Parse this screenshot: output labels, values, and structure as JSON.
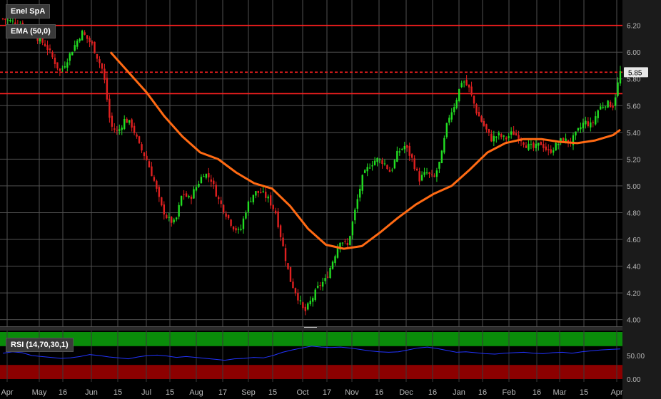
{
  "chart_data": [
    {
      "type": "candlestick",
      "title": "Enel SpA",
      "indicator": "EMA (50,0)",
      "y_ticks": [
        "6.20",
        "6.00",
        "5.80",
        "5.60",
        "5.40",
        "5.20",
        "5.00",
        "4.80",
        "4.60",
        "4.40",
        "4.20",
        "4.00"
      ],
      "ylim": [
        3.95,
        6.39
      ],
      "last_price": "5.85",
      "horizontal_lines": [
        {
          "value": 6.2,
          "style": "solid"
        },
        {
          "value": 5.85,
          "style": "dashed"
        },
        {
          "value": 5.69,
          "style": "solid"
        }
      ],
      "x_labels": [
        "Apr",
        "May",
        "16",
        "Jun",
        "15",
        "Jul",
        "15",
        "Aug",
        "17",
        "Sep",
        "15",
        "Oct",
        "17",
        "Nov",
        "16",
        "Dec",
        "16",
        "Jan",
        "16",
        "Feb",
        "16",
        "Mar",
        "15",
        "Apr"
      ],
      "close_path": [
        [
          0,
          6.25
        ],
        [
          6,
          6.2
        ],
        [
          12,
          6.05
        ],
        [
          16,
          5.85
        ],
        [
          19,
          6.0
        ],
        [
          22,
          6.15
        ],
        [
          25,
          6.05
        ],
        [
          28,
          5.85
        ],
        [
          30,
          5.45
        ],
        [
          32,
          5.4
        ],
        [
          34,
          5.5
        ],
        [
          36,
          5.45
        ],
        [
          38,
          5.3
        ],
        [
          40,
          5.2
        ],
        [
          42,
          5.05
        ],
        [
          44,
          4.85
        ],
        [
          46,
          4.75
        ],
        [
          48,
          4.72
        ],
        [
          50,
          4.95
        ],
        [
          52,
          4.9
        ],
        [
          54,
          5.0
        ],
        [
          56,
          5.1
        ],
        [
          58,
          5.05
        ],
        [
          60,
          4.9
        ],
        [
          62,
          4.8
        ],
        [
          64,
          4.7
        ],
        [
          66,
          4.65
        ],
        [
          68,
          4.85
        ],
        [
          70,
          4.95
        ],
        [
          72,
          4.95
        ],
        [
          74,
          4.9
        ],
        [
          76,
          4.8
        ],
        [
          78,
          4.55
        ],
        [
          80,
          4.3
        ],
        [
          82,
          4.18
        ],
        [
          84,
          4.05
        ],
        [
          86,
          4.15
        ],
        [
          88,
          4.25
        ],
        [
          90,
          4.3
        ],
        [
          92,
          4.45
        ],
        [
          94,
          4.6
        ],
        [
          96,
          4.55
        ],
        [
          98,
          4.8
        ],
        [
          100,
          5.05
        ],
        [
          102,
          5.15
        ],
        [
          104,
          5.2
        ],
        [
          106,
          5.18
        ],
        [
          108,
          5.1
        ],
        [
          110,
          5.25
        ],
        [
          112,
          5.3
        ],
        [
          114,
          5.2
        ],
        [
          116,
          5.05
        ],
        [
          118,
          5.1
        ],
        [
          120,
          5.05
        ],
        [
          122,
          5.2
        ],
        [
          124,
          5.5
        ],
        [
          126,
          5.62
        ],
        [
          128,
          5.8
        ],
        [
          130,
          5.72
        ],
        [
          132,
          5.55
        ],
        [
          134,
          5.45
        ],
        [
          136,
          5.35
        ],
        [
          138,
          5.38
        ],
        [
          140,
          5.35
        ],
        [
          142,
          5.4
        ],
        [
          144,
          5.36
        ],
        [
          146,
          5.3
        ],
        [
          148,
          5.28
        ],
        [
          150,
          5.32
        ],
        [
          152,
          5.25
        ],
        [
          154,
          5.3
        ],
        [
          156,
          5.35
        ],
        [
          158,
          5.32
        ],
        [
          160,
          5.4
        ],
        [
          162,
          5.48
        ],
        [
          164,
          5.45
        ],
        [
          166,
          5.58
        ],
        [
          168,
          5.62
        ],
        [
          170,
          5.6
        ],
        [
          172,
          5.85
        ]
      ],
      "ema_path": [
        [
          30,
          6.0
        ],
        [
          35,
          5.85
        ],
        [
          40,
          5.7
        ],
        [
          45,
          5.52
        ],
        [
          50,
          5.37
        ],
        [
          55,
          5.25
        ],
        [
          60,
          5.2
        ],
        [
          65,
          5.1
        ],
        [
          70,
          5.02
        ],
        [
          75,
          4.98
        ],
        [
          80,
          4.85
        ],
        [
          85,
          4.68
        ],
        [
          90,
          4.56
        ],
        [
          95,
          4.53
        ],
        [
          100,
          4.55
        ],
        [
          105,
          4.65
        ],
        [
          110,
          4.76
        ],
        [
          115,
          4.86
        ],
        [
          120,
          4.94
        ],
        [
          125,
          5.0
        ],
        [
          130,
          5.12
        ],
        [
          135,
          5.25
        ],
        [
          140,
          5.32
        ],
        [
          145,
          5.35
        ],
        [
          150,
          5.35
        ],
        [
          155,
          5.33
        ],
        [
          160,
          5.32
        ],
        [
          165,
          5.34
        ],
        [
          170,
          5.38
        ],
        [
          172,
          5.42
        ]
      ]
    },
    {
      "type": "line",
      "title": "RSI (14,70,30,1)",
      "y_ticks": [
        "50.00",
        "0.00"
      ],
      "ylim": [
        0,
        100
      ],
      "bands": [
        {
          "from": 70,
          "to": 100,
          "color": "#0a8c0a"
        },
        {
          "from": 0,
          "to": 30,
          "color": "#8c0000"
        }
      ],
      "series": [
        {
          "values": [
            55,
            58,
            56,
            50,
            48,
            46,
            44,
            45,
            48,
            52,
            50,
            47,
            45,
            43,
            47,
            50,
            51,
            49,
            46,
            48,
            46,
            44,
            42,
            40,
            43,
            44,
            46,
            45,
            50,
            57,
            62,
            66,
            70,
            68,
            67,
            68,
            66,
            63,
            60,
            58,
            57,
            58,
            62,
            66,
            68,
            65,
            61,
            57,
            58,
            56,
            54,
            53,
            55,
            56,
            57,
            55,
            54,
            56,
            57,
            55,
            58,
            60,
            62,
            63,
            64
          ]
        }
      ]
    }
  ],
  "colors": {
    "up": "#22dd22",
    "down": "#e02020",
    "ema": "#ff6a13",
    "hline": "#ff2020",
    "rsi": "#2233ff",
    "grid": "#505050",
    "axis_text": "#b8b8b8"
  }
}
